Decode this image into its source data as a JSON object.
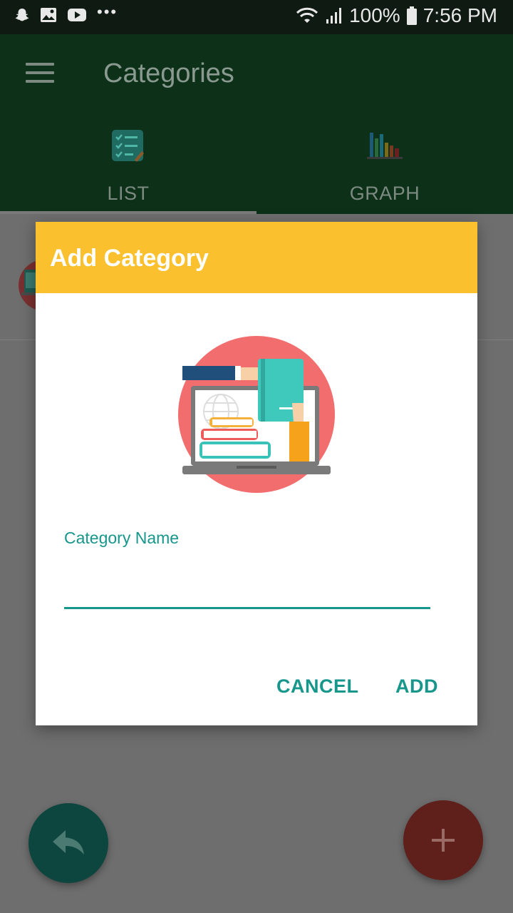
{
  "status_bar": {
    "battery_percent": "100%",
    "time": "7:56 PM",
    "left_icons": [
      "snapchat-icon",
      "gallery-icon",
      "youtube-icon",
      "more-dots-icon"
    ],
    "right_icons": [
      "wifi-icon",
      "signal-icon",
      "battery-icon"
    ]
  },
  "app_bar": {
    "title": "Categories",
    "menu_icon": "menu-icon"
  },
  "tabs": [
    {
      "label": "LIST",
      "icon": "checklist-icon",
      "selected": true
    },
    {
      "label": "GRAPH",
      "icon": "bar-chart-icon",
      "selected": false
    }
  ],
  "dialog": {
    "title": "Add Category",
    "illustration": "books-laptop-illustration",
    "field_label": "Category Name",
    "field_value": "",
    "cancel_label": "CANCEL",
    "add_label": "ADD"
  },
  "fabs": {
    "back_icon": "reply-arrow-icon",
    "add_icon": "plus-icon"
  },
  "colors": {
    "app_bar": "#0d3118",
    "dialog_header": "#fbc02d",
    "accent_teal": "#17968c",
    "fab_back": "#0c463f",
    "fab_add": "#5f1f1a"
  }
}
